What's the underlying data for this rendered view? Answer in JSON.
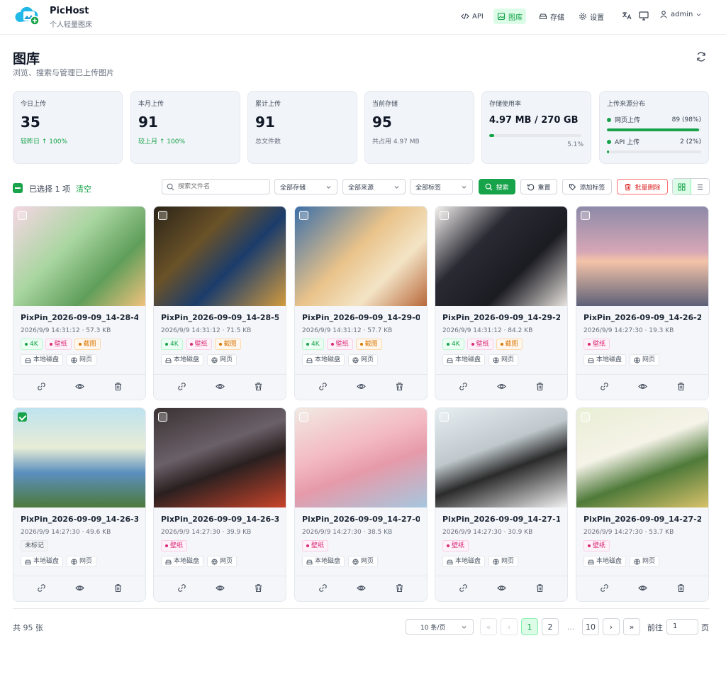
{
  "app": {
    "brand": "PicHost",
    "tagline": "个人轻量图床"
  },
  "nav": [
    {
      "label": "API",
      "icon": "code-icon"
    },
    {
      "label": "图库",
      "icon": "gallery-icon",
      "active": true
    },
    {
      "label": "存储",
      "icon": "storage-icon"
    },
    {
      "label": "设置",
      "icon": "gear-icon"
    }
  ],
  "user": {
    "name": "admin"
  },
  "page": {
    "title": "图库",
    "subtitle": "浏览、搜索与管理已上传图片"
  },
  "stats": {
    "today": {
      "label": "今日上传",
      "value": "35",
      "note": "较昨日 ↑ 100%"
    },
    "month": {
      "label": "本月上传",
      "value": "91",
      "note": "较上月 ↑ 100%"
    },
    "total": {
      "label": "累计上传",
      "value": "91",
      "note": "总文件数"
    },
    "current": {
      "label": "当前存储",
      "value": "95",
      "note": "共占用 4.97 MB"
    },
    "usage": {
      "label": "存储使用率",
      "value": "4.97 MB / 270 GB",
      "percent_label": "5.1%",
      "percent": 5.1
    },
    "sources": {
      "label": "上传来源分布",
      "items": [
        {
          "name": "网页上传",
          "count": "89 (98%)",
          "percent": 98
        },
        {
          "name": "API 上传",
          "count": "2 (2%)",
          "percent": 2
        }
      ]
    }
  },
  "toolbar": {
    "selected": "已选择 1 项",
    "clear": "清空",
    "search_placeholder": "搜索文件名",
    "filter_storage": "全部存储",
    "filter_source": "全部来源",
    "filter_tag": "全部标签",
    "search_btn": "搜索",
    "reset_btn": "重置",
    "add_tag_btn": "添加标签",
    "batch_delete_btn": "批量删除"
  },
  "source_labels": {
    "disk": "本地磁盘",
    "web": "网页"
  },
  "images": [
    {
      "name": "PixPin_2026-09-09_14-28-4...",
      "meta": "2026/9/9 14:31:12 · 57.3 KB",
      "tags": [
        "4K",
        "壁纸",
        "截图"
      ]
    },
    {
      "name": "PixPin_2026-09-09_14-28-5...",
      "meta": "2026/9/9 14:31:12 · 71.5 KB",
      "tags": [
        "4K",
        "壁纸",
        "截图"
      ]
    },
    {
      "name": "PixPin_2026-09-09_14-29-0...",
      "meta": "2026/9/9 14:31:12 · 57.7 KB",
      "tags": [
        "4K",
        "壁纸",
        "截图"
      ]
    },
    {
      "name": "PixPin_2026-09-09_14-29-2...",
      "meta": "2026/9/9 14:31:12 · 84.2 KB",
      "tags": [
        "4K",
        "壁纸",
        "截图"
      ]
    },
    {
      "name": "PixPin_2026-09-09_14-26-2...",
      "meta": "2026/9/9 14:27:30 · 19.3 KB",
      "tags": [
        "壁纸"
      ]
    },
    {
      "name": "PixPin_2026-09-09_14-26-3...",
      "meta": "2026/9/9 14:27:30 · 49.6 KB",
      "tags": [
        "未标记"
      ],
      "checked": true
    },
    {
      "name": "PixPin_2026-09-09_14-26-3...",
      "meta": "2026/9/9 14:27:30 · 39.9 KB",
      "tags": [
        "壁纸"
      ]
    },
    {
      "name": "PixPin_2026-09-09_14-27-0...",
      "meta": "2026/9/9 14:27:30 · 38.5 KB",
      "tags": [
        "壁纸"
      ]
    },
    {
      "name": "PixPin_2026-09-09_14-27-1...",
      "meta": "2026/9/9 14:27:30 · 30.9 KB",
      "tags": [
        "壁纸"
      ]
    },
    {
      "name": "PixPin_2026-09-09_14-27-2...",
      "meta": "2026/9/9 14:27:30 · 53.7 KB",
      "tags": [
        "壁纸"
      ]
    }
  ],
  "pagination": {
    "total": "共 95 张",
    "page_size": "10 条/页",
    "pages": [
      "1",
      "2",
      "...",
      "10"
    ],
    "current": "1",
    "goto_label": "前往",
    "goto_value": "1",
    "goto_suffix": "页"
  },
  "colors": {
    "accent": "#16a34a",
    "danger": "#dc2626"
  }
}
